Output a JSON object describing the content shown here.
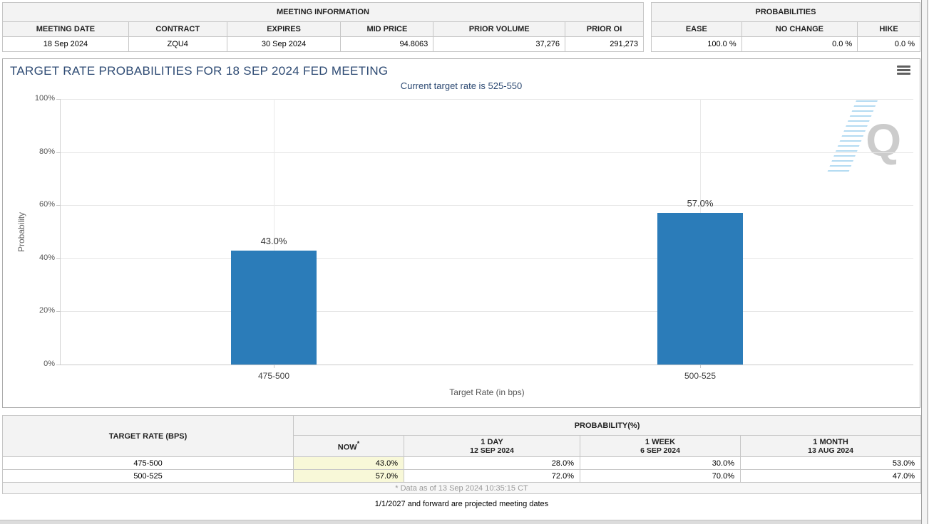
{
  "meeting_information": {
    "title": "MEETING INFORMATION",
    "columns": [
      "MEETING DATE",
      "CONTRACT",
      "EXPIRES",
      "MID PRICE",
      "PRIOR VOLUME",
      "PRIOR OI"
    ],
    "row": [
      "18 Sep 2024",
      "ZQU4",
      "30 Sep 2024",
      "94.8063",
      "37,276",
      "291,273"
    ]
  },
  "probabilities_summary": {
    "title": "PROBABILITIES",
    "columns": [
      "EASE",
      "NO CHANGE",
      "HIKE"
    ],
    "row": [
      "100.0 %",
      "0.0 %",
      "0.0 %"
    ]
  },
  "chart_data": {
    "type": "bar",
    "title": "TARGET RATE PROBABILITIES FOR 18 SEP 2024 FED MEETING",
    "subtitle": "Current target rate is 525-550",
    "categories": [
      "475-500",
      "500-525"
    ],
    "values": [
      43.0,
      57.0
    ],
    "data_labels": [
      "43.0%",
      "57.0%"
    ],
    "xlabel": "Target Rate (in bps)",
    "ylabel": "Probability",
    "ylim": [
      0,
      100
    ],
    "yticks": [
      "0%",
      "20%",
      "40%",
      "60%",
      "80%",
      "100%"
    ],
    "grid": true,
    "legend": "none",
    "bar_color": "#2b7cb9"
  },
  "icons": {
    "chart_menu": "hamburger-menu-icon",
    "watermark_letter": "Q"
  },
  "colors": {
    "accent_navy": "#2d4a73",
    "bar_blue": "#2b7cb9",
    "now_highlight": "#f8f8d8",
    "header_gray": "#f3f3f3"
  },
  "probability_table": {
    "target_rate_header": "TARGET RATE (BPS)",
    "probability_header": "PROBABILITY(%)",
    "now_label": "NOW",
    "now_asterisk": "*",
    "history_columns": [
      {
        "label": "1 DAY",
        "date": "12 SEP 2024"
      },
      {
        "label": "1 WEEK",
        "date": "6 SEP 2024"
      },
      {
        "label": "1 MONTH",
        "date": "13 AUG 2024"
      }
    ],
    "rows": [
      {
        "target_rate": "475-500",
        "now": "43.0%",
        "one_day": "28.0%",
        "one_week": "30.0%",
        "one_month": "53.0%"
      },
      {
        "target_rate": "500-525",
        "now": "57.0%",
        "one_day": "72.0%",
        "one_week": "70.0%",
        "one_month": "47.0%"
      }
    ],
    "footnote": "* Data as of 13 Sep 2024 10:35:15 CT"
  },
  "footer_note": "1/1/2027 and forward are projected meeting dates"
}
